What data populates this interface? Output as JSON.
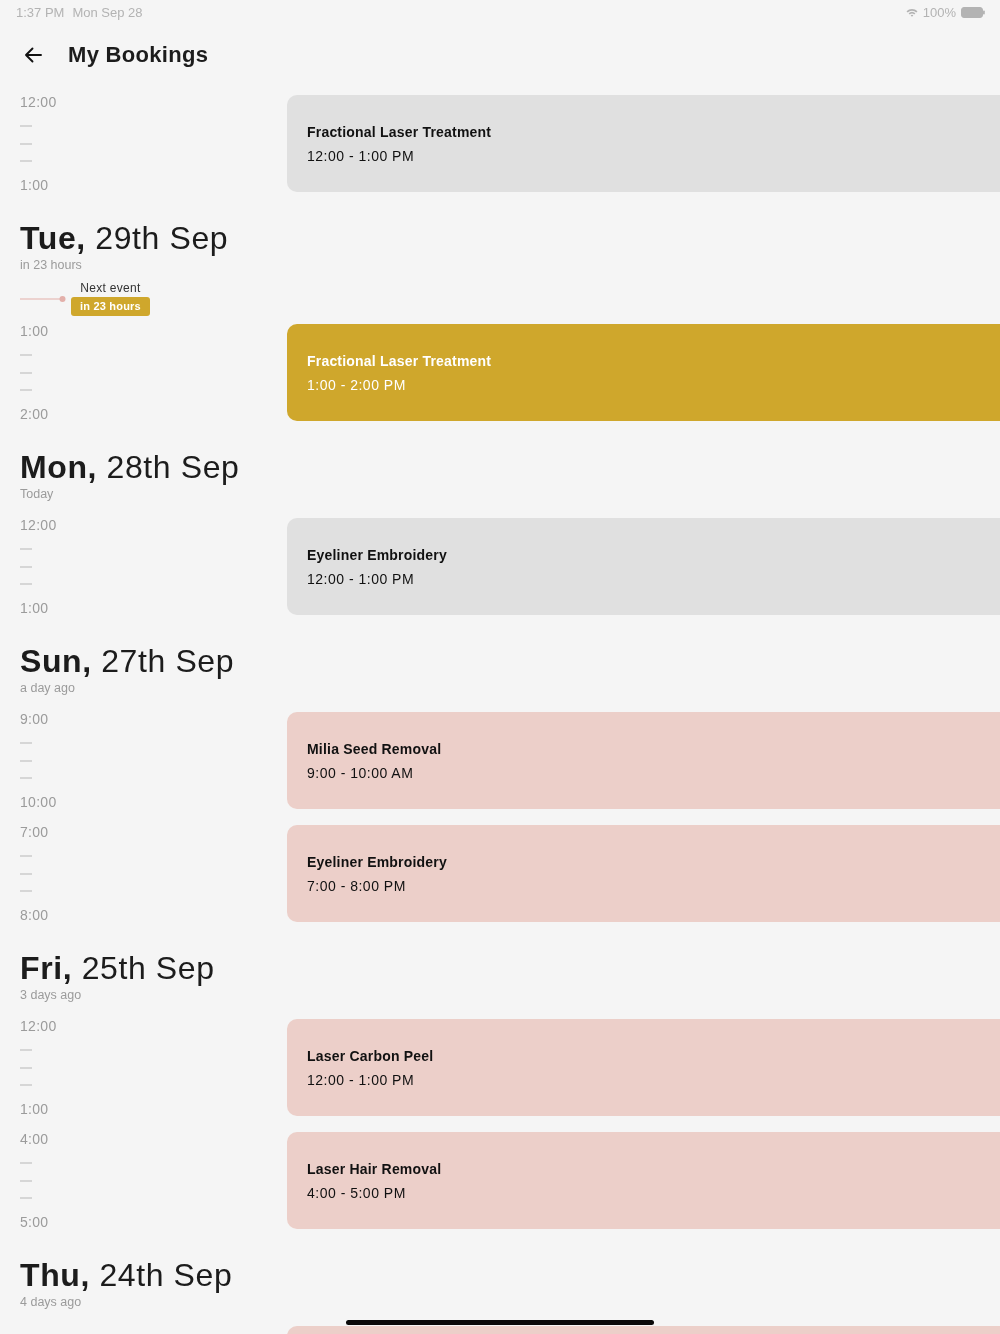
{
  "status_bar": {
    "time": "1:37 PM",
    "date": "Mon Sep 28",
    "battery": "100%"
  },
  "header": {
    "title": "My Bookings"
  },
  "days": [
    {
      "bookings": [
        {
          "start": "12:00",
          "end": "1:00",
          "title": "Fractional Laser Treatment",
          "time": "12:00 - 1:00 PM",
          "color": "#e0e0e0"
        }
      ]
    },
    {
      "heading": "**Tue,** 29th Sep",
      "relative": "in 23 hours",
      "next_event": {
        "label": "Next event",
        "badge": "in 23 hours"
      },
      "bookings": [
        {
          "start": "1:00",
          "end": "2:00",
          "title": "Fractional Laser Treatment",
          "time": "1:00 - 2:00 PM",
          "color": "#cfa72c"
        }
      ]
    },
    {
      "heading": "**Mon,** 28th Sep",
      "relative": "Today",
      "bookings": [
        {
          "start": "12:00",
          "end": "1:00",
          "title": "Eyeliner Embroidery",
          "time": "12:00 - 1:00 PM",
          "color": "#e0e0e0"
        }
      ]
    },
    {
      "heading": "**Sun,** 27th Sep",
      "relative": "a day ago",
      "bookings": [
        {
          "start": "9:00",
          "end": "10:00",
          "title": "Milia Seed Removal",
          "time": "9:00 - 10:00 AM",
          "color": "#eccfc9"
        },
        {
          "start": "7:00",
          "end": "8:00",
          "title": "Eyeliner Embroidery",
          "time": "7:00 - 8:00 PM",
          "color": "#eccfc9"
        }
      ]
    },
    {
      "heading": "**Fri,** 25th Sep",
      "relative": "3 days ago",
      "bookings": [
        {
          "start": "12:00",
          "end": "1:00",
          "title": "Laser Carbon Peel",
          "time": "12:00 - 1:00 PM",
          "color": "#eccfc9"
        },
        {
          "start": "4:00",
          "end": "5:00",
          "title": "Laser Hair Removal",
          "time": "4:00 - 5:00 PM",
          "color": "#eccfc9"
        }
      ]
    },
    {
      "heading": "**Thu,** 24th Sep",
      "relative": "4 days ago",
      "bookings": [
        {
          "color": "#eccfc9"
        }
      ]
    }
  ]
}
